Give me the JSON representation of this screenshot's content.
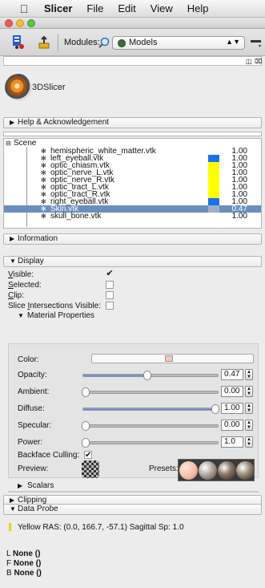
{
  "menubar": {
    "apple": "",
    "app": "Slicer",
    "items": [
      "File",
      "Edit",
      "View",
      "Help"
    ]
  },
  "toolbar": {
    "modules_label": "Modules:",
    "module_selected": "Models"
  },
  "logo_text": "3DSlicer",
  "sections": {
    "help": "Help & Acknowledgement",
    "information": "Information",
    "display": "Display",
    "clipping": "Clipping",
    "data_probe": "Data Probe"
  },
  "scene": {
    "root": "Scene",
    "rows": [
      {
        "name": "hemispheric_white_matter.vtk",
        "color": "",
        "opacity": "1.00"
      },
      {
        "name": "left_eyeball.vtk",
        "color": "#1a73e8",
        "opacity": "1.00"
      },
      {
        "name": "optic_chiasm.vtk",
        "color": "#ffff00",
        "opacity": "1.00"
      },
      {
        "name": "optic_nerve_L.vtk",
        "color": "#ffff00",
        "opacity": "1.00"
      },
      {
        "name": "optic_nerve_R.vtk",
        "color": "#ffff00",
        "opacity": "1.00"
      },
      {
        "name": "optic_tract_L.vtk",
        "color": "#ffff00",
        "opacity": "1.00"
      },
      {
        "name": "optic_tract_R.vtk",
        "color": "#ffff00",
        "opacity": "1.00"
      },
      {
        "name": "right_eyeball.vtk",
        "color": "#1a73e8",
        "opacity": "1.00"
      },
      {
        "name": "Skin.vtk",
        "color": "#9fb0c8",
        "opacity": "0.47"
      },
      {
        "name": "skull_bone.vtk",
        "color": "",
        "opacity": "1.00"
      }
    ]
  },
  "display": {
    "visible_label": "isible:",
    "visible_u": "V",
    "visible_checked": true,
    "selected_label": "elected:",
    "selected_u": "S",
    "selected_checked": false,
    "clip_label": "lip:",
    "clip_u": "C",
    "clip_checked": false,
    "slice_label_a": "Slice ",
    "slice_u": "I",
    "slice_label_b": "ntersections Visible:",
    "slice_checked": false,
    "material_title": "Material Properties",
    "color_label": "Color:",
    "color_value": "#f7c6b4",
    "opacity_label": "Opacity:",
    "opacity_value": "0.47",
    "opacity_fraction": 0.47,
    "ambient_label": "Ambient:",
    "ambient_value": "0.00",
    "ambient_fraction": 0.0,
    "diffuse_label": "Diffuse:",
    "diffuse_value": "1.00",
    "diffuse_fraction": 1.0,
    "specular_label": "Specular:",
    "specular_value": "0.00",
    "specular_fraction": 0.0,
    "power_label": "Power:",
    "power_value": "1.0",
    "power_fraction": 0.0,
    "backface_label": "Backface Culling:",
    "backface_checked": true,
    "preview_label": "Preview:",
    "presets_label": "Presets:",
    "scalars_title": "Scalars"
  },
  "probe": {
    "line1": "Yellow  RAS: (0.0, 166.7, -57.1)  Sagittal  Sp: 1.0",
    "l_prefix": "L ",
    "f_prefix": "F ",
    "b_prefix": "B ",
    "l_value": "None ()",
    "f_value": "None ()",
    "b_value": "None ()"
  }
}
